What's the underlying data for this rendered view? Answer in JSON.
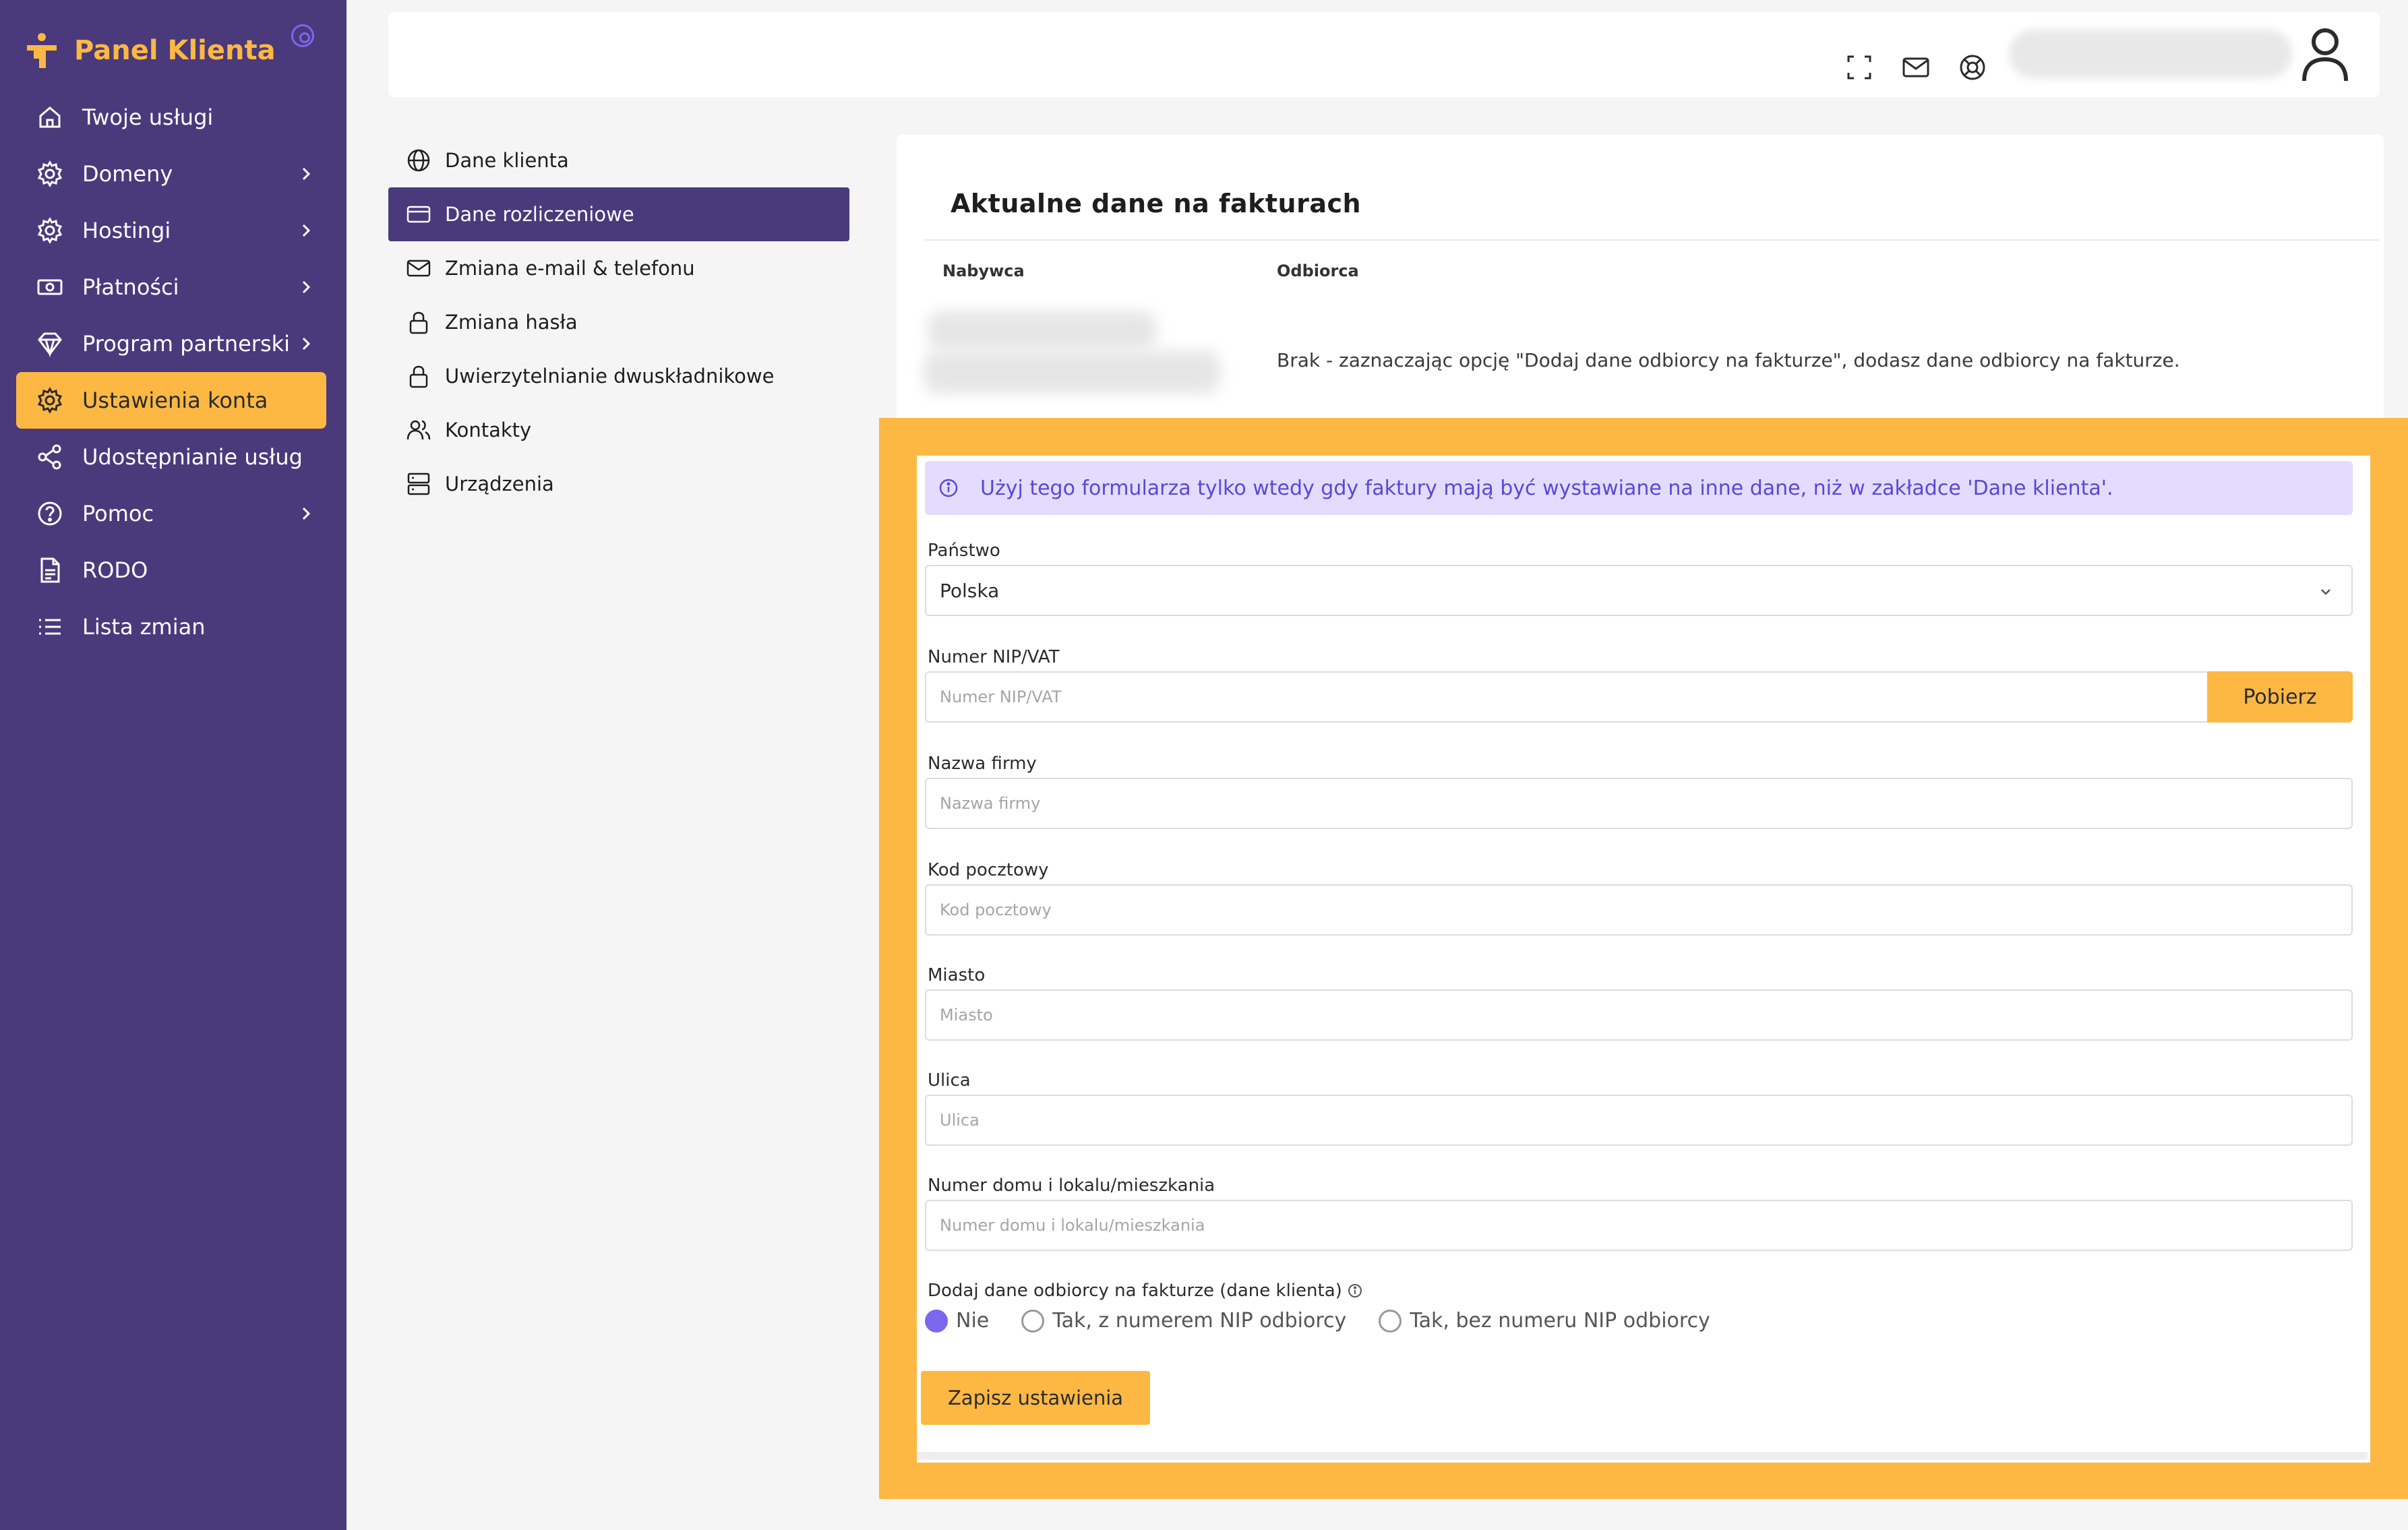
{
  "brand": {
    "name": "Panel Klienta"
  },
  "sidebar": {
    "items": [
      {
        "label": "Twoje usługi",
        "icon": "home-icon",
        "chevron": false,
        "active": false
      },
      {
        "label": "Domeny",
        "icon": "gear-icon",
        "chevron": true,
        "active": false
      },
      {
        "label": "Hostingi",
        "icon": "gear-icon",
        "chevron": true,
        "active": false
      },
      {
        "label": "Płatności",
        "icon": "money-icon",
        "chevron": true,
        "active": false
      },
      {
        "label": "Program partnerski",
        "icon": "diamond-icon",
        "chevron": true,
        "active": false
      },
      {
        "label": "Ustawienia konta",
        "icon": "gear-icon",
        "chevron": false,
        "active": true
      },
      {
        "label": "Udostępnianie usług",
        "icon": "share-icon",
        "chevron": false,
        "active": false
      },
      {
        "label": "Pomoc",
        "icon": "help-icon",
        "chevron": true,
        "active": false
      },
      {
        "label": "RODO",
        "icon": "document-icon",
        "chevron": false,
        "active": false
      },
      {
        "label": "Lista zmian",
        "icon": "list-icon",
        "chevron": false,
        "active": false
      }
    ]
  },
  "topbar": {
    "icons": [
      "fullscreen-icon",
      "mail-icon",
      "support-icon",
      "user-icon"
    ]
  },
  "submenu": {
    "items": [
      {
        "label": "Dane klienta",
        "icon": "globe-icon",
        "active": false
      },
      {
        "label": "Dane rozliczeniowe",
        "icon": "credit-card-icon",
        "active": true
      },
      {
        "label": "Zmiana e-mail & telefonu",
        "icon": "mail-icon",
        "active": false
      },
      {
        "label": "Zmiana hasła",
        "icon": "lock-icon",
        "active": false
      },
      {
        "label": "Uwierzytelnianie dwuskładnikowe",
        "icon": "lock-icon",
        "active": false
      },
      {
        "label": "Kontakty",
        "icon": "users-icon",
        "active": false
      },
      {
        "label": "Urządzenia",
        "icon": "server-icon",
        "active": false
      }
    ]
  },
  "invoice_card": {
    "title": "Aktualne dane na fakturach",
    "col_buyer": "Nabywca",
    "col_recipient": "Odbiorca",
    "recipient_text": "Brak - zaznaczając opcję \"Dodaj dane odbiorcy na fakturze\", dodasz dane odbiorcy na fakturze."
  },
  "form": {
    "info": "Użyj tego formularza tylko wtedy gdy faktury mają być wystawiane na inne dane, niż w zakładce 'Dane klienta'.",
    "country": {
      "label": "Państwo",
      "value": "Polska"
    },
    "nip": {
      "label": "Numer NIP/VAT",
      "placeholder": "Numer NIP/VAT",
      "button": "Pobierz"
    },
    "company": {
      "label": "Nazwa firmy",
      "placeholder": "Nazwa firmy"
    },
    "postal": {
      "label": "Kod pocztowy",
      "placeholder": "Kod pocztowy"
    },
    "city": {
      "label": "Miasto",
      "placeholder": "Miasto"
    },
    "street": {
      "label": "Ulica",
      "placeholder": "Ulica"
    },
    "house": {
      "label": "Numer domu i lokalu/mieszkania",
      "placeholder": "Numer domu i lokalu/mieszkania"
    },
    "recipient_option": {
      "label": "Dodaj dane odbiorcy na fakturze (dane klienta)",
      "options": [
        "Nie",
        "Tak, z numerem NIP odbiorcy",
        "Tak, bez numeru NIP odbiorcy"
      ],
      "selected": "Nie"
    },
    "save": "Zapisz ustawienia"
  },
  "colors": {
    "sidebar_bg": "#4a3a7c",
    "accent": "#fdb844",
    "radio_selected": "#7b68ee",
    "info_bg": "#e3dcff",
    "info_text": "#5a48d6"
  }
}
